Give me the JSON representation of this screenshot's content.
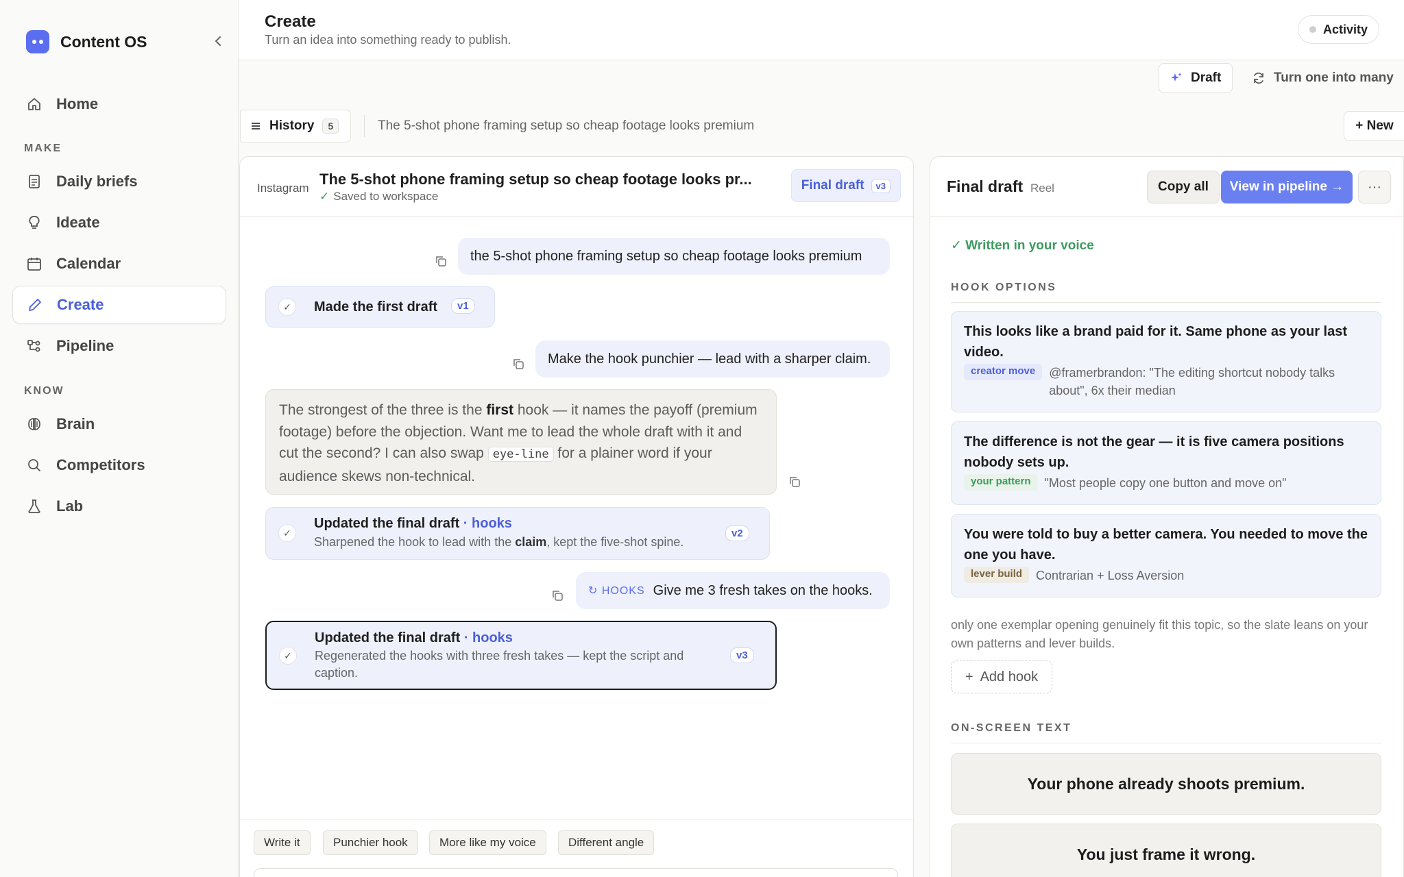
{
  "app": {
    "name": "Content OS"
  },
  "sidebar": {
    "items": [
      {
        "label": "Home",
        "icon": "home-icon"
      },
      {
        "label": "Daily briefs",
        "icon": "document-icon"
      },
      {
        "label": "Ideate",
        "icon": "lightbulb-icon"
      },
      {
        "label": "Calendar",
        "icon": "calendar-icon"
      },
      {
        "label": "Create",
        "icon": "pencil-icon",
        "active": true
      },
      {
        "label": "Pipeline",
        "icon": "pipeline-icon"
      },
      {
        "label": "Brain",
        "icon": "brain-icon"
      },
      {
        "label": "Competitors",
        "icon": "search-icon"
      },
      {
        "label": "Lab",
        "icon": "flask-icon"
      }
    ],
    "sections": {
      "make": "MAKE",
      "know": "KNOW"
    }
  },
  "header": {
    "title": "Create",
    "subtitle": "Turn an idea into something ready to publish.",
    "activity_label": "Activity"
  },
  "toolbar": {
    "draft_label": "Draft",
    "turn_label": "Turn one into many"
  },
  "history": {
    "label": "History",
    "count": "5",
    "current_title": "The 5-shot phone framing setup so cheap footage looks premium",
    "new_label": "+ New"
  },
  "chat": {
    "platform": "Instagram",
    "title": "The 5-shot phone framing setup so cheap footage looks pr...",
    "saved": "Saved to workspace",
    "final_tag": "Final draft",
    "final_version": "v3",
    "messages": {
      "user1": "the 5-shot phone framing setup so cheap footage looks premium",
      "step1_title": "Made the first draft",
      "step1_version": "v1",
      "user2": "Make the hook punchier — lead with a sharper claim.",
      "assistant_p1": "The strongest of the three is the ",
      "assistant_bold": "first",
      "assistant_p2": " hook — it names the payoff (premium footage) before the objection. Want me to lead the whole draft with it and cut the second? I can also swap ",
      "assistant_code": "eye-line",
      "assistant_p3": " for a plainer word if your audience skews non-technical.",
      "step2_title": "Updated the final draft",
      "step2_kw": "· hooks",
      "step2_desc_a": "Sharpened the hook to lead with the ",
      "step2_desc_bold": "claim",
      "step2_desc_b": ", kept the five-shot spine.",
      "step2_version": "v2",
      "user3_tag": "HOOKS",
      "user3": "Give me 3 fresh takes on the hooks.",
      "step3_title": "Updated the final draft",
      "step3_kw": "· hooks",
      "step3_desc": "Regenerated the hooks with three fresh takes — kept the script and caption.",
      "step3_version": "v3"
    },
    "chips": [
      "Write it",
      "Punchier hook",
      "More like my voice",
      "Different angle"
    ]
  },
  "panel": {
    "title": "Final draft",
    "type": "Reel",
    "copy_all": "Copy all",
    "view_pipeline": "View in pipeline →",
    "more": "···",
    "voice": "✓ Written in your voice",
    "hook_section": "HOOK OPTIONS",
    "hooks": [
      {
        "text": "This looks like a brand paid for it. Same phone as your last video.",
        "tag": "creator move",
        "meta": "@framerbrandon: \"The editing shortcut nobody talks about\", 6x their median"
      },
      {
        "text": "The difference is not the gear — it is five camera positions nobody sets up.",
        "tag": "your pattern",
        "meta": "\"Most people copy one button and move on\""
      },
      {
        "text": "You were told to buy a better camera. You needed to move the one you have.",
        "tag": "lever build",
        "meta": "Contrarian + Loss Aversion"
      }
    ],
    "note": "only one exemplar opening genuinely fit this topic, so the slate leans on your own patterns and lever builds.",
    "add_hook": "Add hook",
    "ost_section": "ON-SCREEN TEXT",
    "ost": [
      "Your phone already shoots premium.",
      "You just frame it wrong."
    ]
  }
}
